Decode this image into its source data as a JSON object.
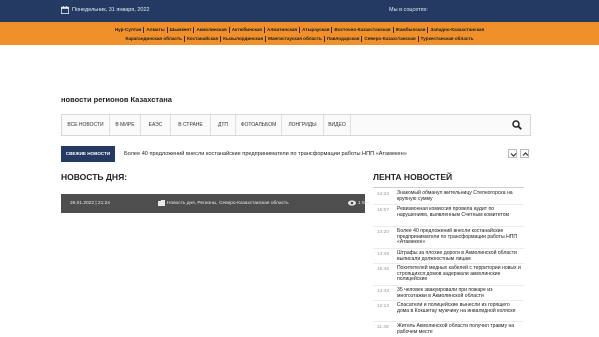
{
  "topbar": {
    "date": "Понедельник, 31 января, 2022",
    "social_label": "Мы в соцсетях:",
    "bg_color": "#243a63"
  },
  "regions": {
    "row1": [
      "Нур-Султан",
      "Алматы",
      "Шымкент",
      "Акмолинская",
      "Актюбинская",
      "Алматинская",
      "Атырауская",
      "Восточно-Казахстанская",
      "Жамбылская",
      "Западно-Казахстанская"
    ],
    "row2": [
      "Карагандинская область",
      "Костанайская",
      "Кызылординская",
      "Мангистауская область",
      "Павлодарская",
      "Северо-Казахстанская",
      "Туркестанская область"
    ],
    "bg_color": "#f0902a"
  },
  "site_title": "новости регионов Казахстана",
  "nav": {
    "items": [
      "ВСЕ НОВОСТИ",
      "В МИРЕ",
      "ЕАЭС",
      "В СТРАНЕ",
      "ДТП",
      "ФОТОАЛЬБОМ",
      "ЛОНГРИДЫ",
      "ВИДЕО"
    ],
    "search_icon": "search-icon"
  },
  "ticker": {
    "label": "СВЕЖИЕ НОВОСТИ",
    "text": "Более 40 предложений внесли костанайские предприниматели по трансформации работы НПП «Атамекен»"
  },
  "news_of_day": {
    "heading": "НОВОСТЬ ДНЯ:",
    "meta": "26.01.2022 | 21:24",
    "categories": "Новость дня, Регионы, Северо-Казахстанская область",
    "views": "1 896"
  },
  "feed": {
    "heading": "ЛЕНТА НОВОСТЕЙ",
    "items": [
      {
        "time": "14:23",
        "title": "Знакомый обманул жительницу Степногорска на крупную сумму"
      },
      {
        "time": "15:07",
        "title": "Ревизионная комиссия провела аудит по нарушениям, выявленным Счетным комитетом"
      },
      {
        "time": "14:20",
        "title": "Более 40 предложений внесли костанайские предприниматели по трансформации работы НПП «Атамекен»"
      },
      {
        "time": "13:49",
        "title": "Штрафы за плохие дороги в Акмолинской области выписали должностным лицам"
      },
      {
        "time": "15:45",
        "title": "Похитителей медных кабелей с территории новых и строящихся домов задержали акмолинские полицейские"
      },
      {
        "time": "14:43",
        "title": "35 человек эвакуировали при пожаре из многоэтажки в Акмолинской области"
      },
      {
        "time": "12:13",
        "title": "Спасатели и полицейские вынесли из горящего дома в Кокшетау мужчину на инвалидной коляске"
      },
      {
        "time": "11:46",
        "title": "Житель Акмолинской области получил травму на рабочем месте"
      }
    ]
  }
}
